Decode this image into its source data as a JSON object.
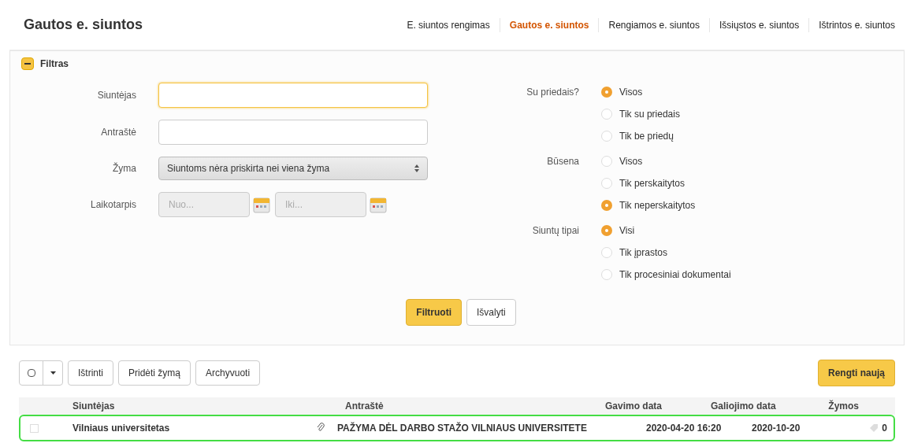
{
  "page_title": "Gautos e. siuntos",
  "nav": [
    {
      "label": "E. siuntos rengimas",
      "selected": false
    },
    {
      "label": "Gautos e. siuntos",
      "selected": true
    },
    {
      "label": "Rengiamos e. siuntos",
      "selected": false
    },
    {
      "label": "Išsiųstos e. siuntos",
      "selected": false
    },
    {
      "label": "Ištrintos e. siuntos",
      "selected": false
    }
  ],
  "filter": {
    "title": "Filtras",
    "expanded": true,
    "fields": [
      {
        "kind": "text",
        "label": "Siuntėjas",
        "focused": true
      },
      {
        "kind": "text",
        "label": "Antraštė",
        "focused": false
      },
      {
        "kind": "select",
        "label": "Žyma",
        "value": "Siuntoms nėra priskirta nei viena žyma"
      },
      {
        "kind": "range",
        "label": "Laikotarpis",
        "from_placeholder": "Nuo...",
        "to_placeholder": "Iki..."
      }
    ],
    "radio_groups": [
      {
        "label": "Su priedais?",
        "options": [
          {
            "label": "Visos",
            "selected": true
          },
          {
            "label": "Tik su priedais",
            "selected": false
          },
          {
            "label": "Tik be priedų",
            "selected": false
          }
        ]
      },
      {
        "label": "Būsena",
        "options": [
          {
            "label": "Visos",
            "selected": false
          },
          {
            "label": "Tik perskaitytos",
            "selected": false
          },
          {
            "label": "Tik neperskaitytos",
            "selected": true
          }
        ]
      },
      {
        "label": "Siuntų tipai",
        "options": [
          {
            "label": "Visi",
            "selected": true
          },
          {
            "label": "Tik įprastos",
            "selected": false
          },
          {
            "label": "Tik procesiniai dokumentai",
            "selected": false
          }
        ]
      }
    ],
    "buttons": [
      {
        "label": "Filtruoti",
        "kind": "primary"
      },
      {
        "label": "Išvalyti",
        "kind": "secondary"
      }
    ]
  },
  "toolbar": {
    "actions": [
      "Ištrinti",
      "Pridėti žymą",
      "Archyvuoti"
    ],
    "new_button": "Rengti naują"
  },
  "table": {
    "columns": [
      "Siuntėjas",
      "Antraštė",
      "Gavimo data",
      "Galiojimo data",
      "Žymos"
    ],
    "rows": [
      {
        "sender": "Vilniaus universitetas",
        "has_attachment": true,
        "title": "PAŽYMA DĖL DARBO STAŽO VILNIAUS UNIVERSITETE",
        "received": "2020-04-20 16:20",
        "valid_until": "2020-10-20",
        "tags": "0",
        "checked": false,
        "selected": true
      }
    ]
  }
}
